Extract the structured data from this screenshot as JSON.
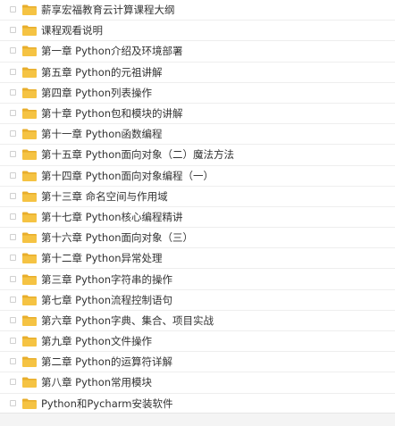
{
  "icons": {
    "folder": "folder-icon",
    "checkbox": "checkbox"
  },
  "colors": {
    "folder": "#F5C343",
    "folder_tab": "#E8AE2C",
    "text": "#333333",
    "row_divider": "#EEEEEE"
  },
  "files": [
    {
      "name": "薪享宏福教育云计算课程大纲",
      "type": "folder"
    },
    {
      "name": "课程观看说明",
      "type": "folder"
    },
    {
      "name": "第一章 Python介绍及环境部署",
      "type": "folder"
    },
    {
      "name": "第五章 Python的元祖讲解",
      "type": "folder"
    },
    {
      "name": "第四章 Python列表操作",
      "type": "folder"
    },
    {
      "name": "第十章 Python包和模块的讲解",
      "type": "folder"
    },
    {
      "name": "第十一章 Python函数编程",
      "type": "folder"
    },
    {
      "name": "第十五章 Python面向对象（二）魔法方法",
      "type": "folder"
    },
    {
      "name": "第十四章 Python面向对象编程（一）",
      "type": "folder"
    },
    {
      "name": "第十三章 命名空间与作用域",
      "type": "folder"
    },
    {
      "name": "第十七章 Python核心编程精讲",
      "type": "folder"
    },
    {
      "name": "第十六章 Python面向对象（三）",
      "type": "folder"
    },
    {
      "name": "第十二章 Python异常处理",
      "type": "folder"
    },
    {
      "name": "第三章 Python字符串的操作",
      "type": "folder"
    },
    {
      "name": "第七章 Python流程控制语句",
      "type": "folder"
    },
    {
      "name": "第六章 Python字典、集合、项目实战",
      "type": "folder"
    },
    {
      "name": "第九章 Python文件操作",
      "type": "folder"
    },
    {
      "name": "第二章 Python的运算符详解",
      "type": "folder"
    },
    {
      "name": "第八章 Python常用模块",
      "type": "folder"
    },
    {
      "name": "Python和Pycharm安装软件",
      "type": "folder"
    }
  ]
}
